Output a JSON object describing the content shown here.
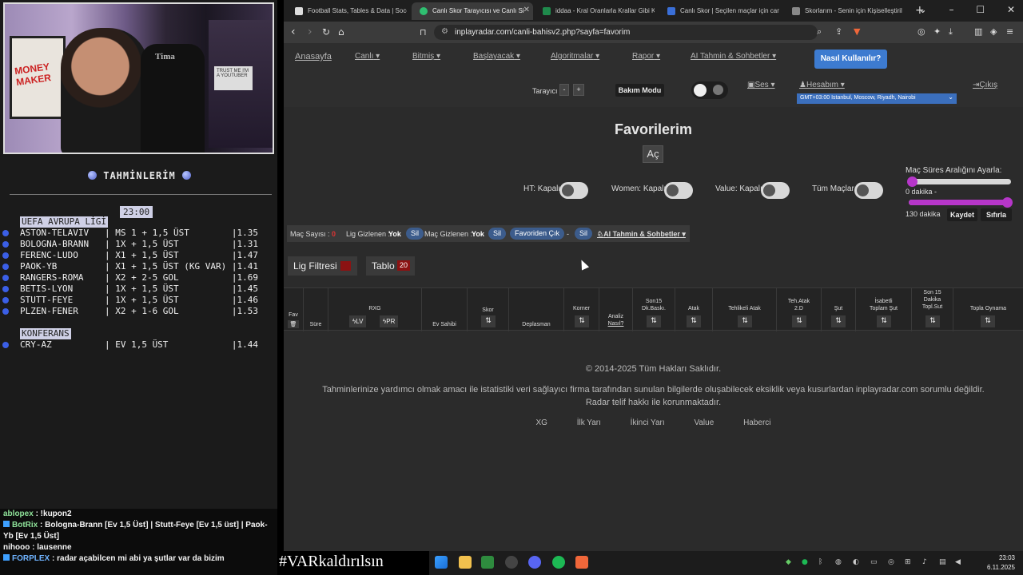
{
  "stream": {
    "cam_poster_text": "MONEY MAKER",
    "cam_chair_text": "Tima",
    "cam_sign_text": "TRUST ME I'M A YOUTUBER",
    "predictions_title": "TAHMİNLERİM",
    "time": "23:00",
    "league1": "UEFA AVRUPA LİGİ",
    "rows1": [
      "ASTON-TELAVIV   | MS 1 + 1,5 ÜST        |1.35",
      "BOLOGNA-BRANN   | 1X + 1,5 ÜST          |1.31",
      "FERENC-LUDO     | X1 + 1,5 ÜST          |1.47",
      "PAOK-YB         | X1 + 1,5 ÜST (KG VAR) |1.41",
      "RANGERS-ROMA    | X2 + 2-5 GOL          |1.69",
      "BETIS-LYON      | 1X + 1,5 ÜST          |1.45",
      "STUTT-FEYE      | 1X + 1,5 ÜST          |1.46",
      "PLZEN-FENER     | X2 + 1-6 GOL          |1.53"
    ],
    "league2": "KONFERANS",
    "rows2": [
      "CRY-AZ          | EV 1,5 ÜST            |1.44"
    ],
    "chat": [
      {
        "user": "ablopex",
        "text": " : !kupon2"
      },
      {
        "user": "BotRix",
        "text": " : Bologna-Brann [Ev 1,5 Üst] | Stutt-Feye [Ev 1,5 üst] | Paok-Yb [Ev 1,5 Üst]"
      },
      {
        "user": "nihooo",
        "text": " : lausenne"
      },
      {
        "user": "FORPLEX",
        "text": " : radar açabilcen mi abi ya şutlar var da bizim"
      }
    ],
    "banner": "#VARkaldırılsın"
  },
  "browser": {
    "tabs": [
      {
        "label": "Football Stats, Tables & Data | Socc",
        "color": "#ffffff"
      },
      {
        "label": "Canlı Skor Tarayıcısı ve Canlı Si",
        "color": "#2fbf71"
      },
      {
        "label": "iddaa - Kral Oranlarla Krallar Gibi K",
        "color": "#1f8a4c"
      },
      {
        "label": "Canlı Skor | Seçilen maçlar için can",
        "color": "#3a6fd8"
      },
      {
        "label": "Skorlarım - Senin için Kişiselleştiril",
        "color": "#888888"
      }
    ],
    "url": "inplayradar.com/canli-bahisv2.php?sayfa=favorim"
  },
  "nav": {
    "home": "Anasayfa",
    "items": [
      "Canlı",
      "Bitmiş",
      "Başlayacak",
      "Algoritmalar",
      "Rapor",
      "AI Tahmin & Sohbetler"
    ],
    "help": "Nasıl Kullanılır?",
    "scanner": "Tarayıcı",
    "minus": "-",
    "plus": "+",
    "maintenance": "Bakım Modu",
    "sound": "Ses",
    "account": "Hesabım",
    "timezone": "GMT+03:00 Istanbul, Moscow, Riyadh, Nairobi",
    "logout": "Çıkış"
  },
  "main": {
    "title": "Favorilerim",
    "open": "Aç",
    "toggles": [
      "HT: Kapalı",
      "Women: Kapalı",
      "Value: Kapalı",
      "Tüm Maçlar"
    ],
    "range_title": "Maç Süres Aralığını Ayarla:",
    "range_min": "0 dakika -",
    "range_max": "130 dakika",
    "range_min_value": 0,
    "range_max_value": 130,
    "save": "Kaydet",
    "reset": "Sıfırla",
    "filter": {
      "match_count": "Maç Sayısı :",
      "match_count_val": "0",
      "hidden_leagues": "Lig Gizlenen :",
      "yok1": "Yok",
      "sil1": "Sil",
      "hidden_matches": "Maç Gizlenen :",
      "yok2": "Yok",
      "sil2": "Sil",
      "fav_out": "Favoriden Çık",
      "dot": "-",
      "sil3": "Sil",
      "ai": "AI Tahmin & Sohbetler"
    },
    "league_filter": "Lig Filtresi",
    "table": "Tablo",
    "table_count": "20",
    "columns": {
      "fav": "Fav",
      "sure": "Süre",
      "rxg": "RXG",
      "lv": "LV",
      "pr": "PR",
      "ev": "Ev Sahibi",
      "skor": "Skor",
      "dep": "Deplasman",
      "korner": "Korner",
      "analiz": "Analiz",
      "nasil": "Nasıl?",
      "son15": "Son15",
      "son15b": "Dk.Baskı.",
      "atak": "Atak",
      "tehlikeli": "Tehlikeli Atak",
      "tehatak": "Teh.Atak",
      "tehatak2": "2.D",
      "sut": "Şut",
      "isabetli": "İsabetli",
      "isabetli2": "Toplam Şut",
      "son15s1": "Son 15",
      "son15s2": "Dakika",
      "son15s3": "Topl.Sut",
      "topla": "Topla Oynama"
    },
    "copyright": "© 2014-2025 Tüm Hakları Saklıdır.",
    "disclaimer1": "Tahminlerinize yardımcı olmak amacı ile istatistiki veri sağlayıcı firma tarafından sunulan bilgilerde oluşabilecek eksiklik veya kusurlardan inplayradar.com sorumlu değildir.",
    "disclaimer2": "Radar telif hakkı ile korunmaktadır.",
    "footer": [
      "XG",
      "İlk Yarı",
      "İkinci Yarı",
      "Value",
      "Haberci"
    ]
  },
  "taskbar": {
    "time": "23:03",
    "date": "6.11.2025"
  }
}
